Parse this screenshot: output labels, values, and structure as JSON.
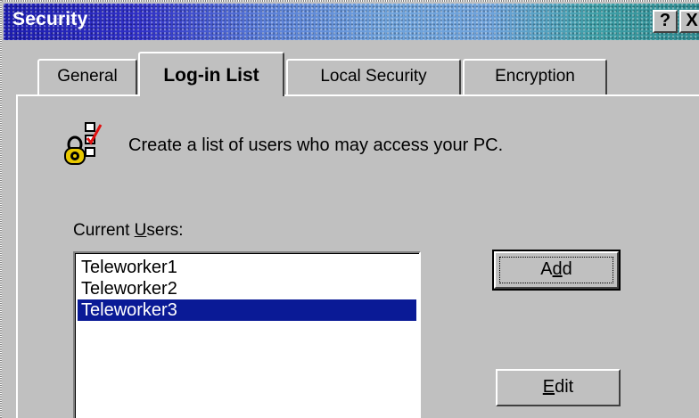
{
  "window": {
    "title": "Security",
    "help_label": "?",
    "close_label": "X"
  },
  "tabs": [
    {
      "label": "General",
      "active": false
    },
    {
      "label": "Log-in List",
      "active": true
    },
    {
      "label": "Local Security",
      "active": false
    },
    {
      "label": "Encryption",
      "active": false
    }
  ],
  "content": {
    "description": "Create a list of users who may access your PC.",
    "users_label_pre": "Current ",
    "users_label_accel": "U",
    "users_label_post": "sers:"
  },
  "users": {
    "items": [
      "Teleworker1",
      "Teleworker2",
      "Teleworker3"
    ],
    "selected": "Teleworker3"
  },
  "buttons": {
    "add_pre": "A",
    "add_accel": "d",
    "add_post": "d",
    "edit_accel": "E",
    "edit_post": "dit"
  },
  "colors": {
    "title_start": "#1c1cb0",
    "title_end": "#2e8a90",
    "selection": "#0a1a96",
    "face": "#c0c0c0"
  }
}
